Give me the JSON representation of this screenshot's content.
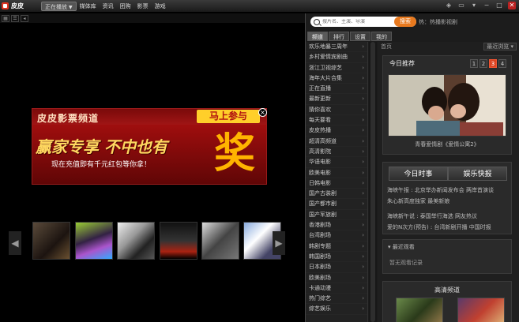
{
  "app": {
    "name": "皮皮"
  },
  "nav": {
    "tabs": [
      "正在播放",
      "媒体库",
      "资讯",
      "团购",
      "影票",
      "游戏"
    ],
    "active": "正在播放"
  },
  "window_controls": [
    "skin-icon",
    "mini-icon",
    "menu-icon",
    "minimize-icon",
    "maximize-icon",
    "close-icon"
  ],
  "ad": {
    "title": "皮皮影票频道",
    "cta": "马上参与",
    "headline": "赢家专享 不中也有",
    "sub": "现在充值即有千元红包等你拿！",
    "big": "奖",
    "close": "×"
  },
  "search": {
    "placeholder": "搜片名、主演、导演",
    "button": "搜索",
    "hot": "热：热播影视剧"
  },
  "sidebar_tabs": [
    "频道",
    "排行",
    "设置",
    "我的"
  ],
  "categories": [
    "欢乐地暴三周年",
    "乡村爱情宾剧曲",
    "浙江卫视综艺",
    "海年大片合集",
    "正在直播",
    "最新更新",
    "猜你喜欢",
    "每天要看",
    "皮皮热播",
    "超清高频道",
    "高清影院",
    "华语电影",
    "欧美电影",
    "日韩电影",
    "国产古装剧",
    "国产都市剧",
    "国产军旅剧",
    "香港剧场",
    "台湾剧场",
    "韩剧专题",
    "韩国剧场",
    "日本剧场",
    "欧美剧场",
    "卡通动漫",
    "热门综艺",
    "综艺娱乐"
  ],
  "panel": {
    "crumb": "首页",
    "recent": "最近浏览",
    "today_title": "今日推荐",
    "pages": [
      "1",
      "2",
      "3",
      "4"
    ],
    "active_page": "3",
    "rec_caption": "青春爱情剧《爱情公寓2》",
    "news_tabs": [
      "今日时事",
      "娱乐快报"
    ],
    "news": [
      "海峡午报 : 北京举办新闻发布会 两岸首演谈",
      "朱心新高度独家 最美新娘",
      "海峡新午说 : 泰国举行海选 网友热议",
      "爱的N次方(预告) : 台湾新剧开播 中国时报"
    ],
    "history_title": "最近观看",
    "history_empty": "暂无观看记录",
    "hd_title": "高清频道"
  }
}
